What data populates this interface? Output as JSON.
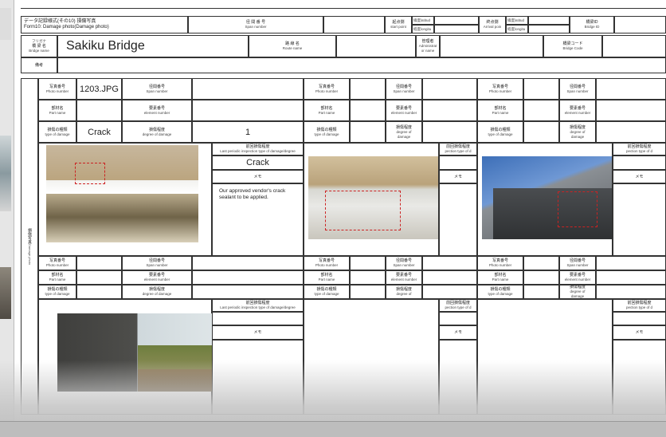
{
  "form": {
    "title_jp": "データ記録様式(その10) 損傷写真",
    "title_en": "Form10: Damage photo(Damage photo)"
  },
  "header": {
    "span_jp": "径 間 番 号",
    "span_en": "Span number",
    "start_jp": "起点側",
    "start_en": "start point",
    "lat_label": "緯度latitud",
    "lon_label": "経度longitu",
    "arrival_jp": "終点側",
    "arrival_en": "Arrival poin",
    "bridgeid_jp": "橋梁ID",
    "bridgeid_en": "Bridge ID",
    "furigana": "フリガナ",
    "bridgename_jp": "橋 梁 名",
    "bridgename_en": "Bridge name",
    "bridge_name": "Sakiku Bridge",
    "route_jp": "路 線 名",
    "route_en": "Route name",
    "admin_jp": "管理者",
    "admin_en1": "Administrat",
    "admin_en2": "or name",
    "code_jp": "橋梁コード",
    "code_en": "Bridge Code",
    "notes_jp": "備考"
  },
  "labels": {
    "photo_number_jp": "写真番号",
    "photo_number_en": "Photo number",
    "span_number_jp": "径間番号",
    "span_number_en": "Span number",
    "part_name_jp": "部材名",
    "part_name_en": "Part name",
    "element_number_jp": "要素番号",
    "element_number_en": "element number",
    "type_damage_jp": "損傷の種類",
    "type_damage_en": "type of damage",
    "degree_jp": "損傷程度",
    "degree_en": "degree of damage",
    "degree_en_a": "degree of",
    "degree_en_b": "damage",
    "prev_jp": "前回損傷程度",
    "prev_en": "Last periodic inspection type of damage/degree",
    "prev_en_short": "pection type of d",
    "memo": "メモ",
    "side_jp": "損傷写真",
    "side_en": "Damage photo"
  },
  "entry1": {
    "photo_number": "1203.JPG",
    "damage_type": "Crack",
    "degree": "1",
    "prev_value": "Crack",
    "memo_text": "Our approved vendor's crack sealant to be applied."
  }
}
